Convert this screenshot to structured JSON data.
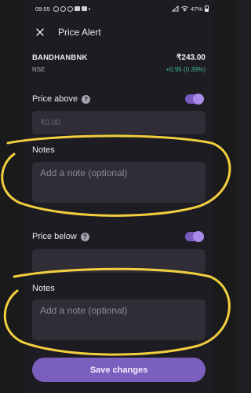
{
  "status_bar": {
    "time": "09:55",
    "more": "•",
    "battery": "47%",
    "icons": [
      "whatsapp-icon",
      "chat-icon",
      "messenger-icon",
      "bag-icon",
      "mail-icon",
      "signal-icon",
      "wifi-icon",
      "battery-icon"
    ]
  },
  "header": {
    "title": "Price Alert",
    "close_icon": "close-icon"
  },
  "stock": {
    "symbol": "BANDHANBNK",
    "exchange": "NSE",
    "price": "₹243.00",
    "change": "+0.95 (0.39%)",
    "change_color": "#3fb98a"
  },
  "price_above": {
    "label": "Price above",
    "info_icon": "?",
    "toggle_on": true,
    "placeholder": "₹0.00"
  },
  "notes_above": {
    "label": "Notes",
    "placeholder": "Add a note (optional)"
  },
  "price_below": {
    "label": "Price below",
    "info_icon": "?",
    "toggle_on": true,
    "value": ""
  },
  "notes_below": {
    "label": "Notes",
    "placeholder": "Add a note (optional)"
  },
  "save_button": {
    "label": "Save changes"
  },
  "colors": {
    "accent": "#7b5fbe",
    "background": "#1e1c23",
    "input_bg": "#302d36",
    "annotation": "#f2cf3f"
  }
}
